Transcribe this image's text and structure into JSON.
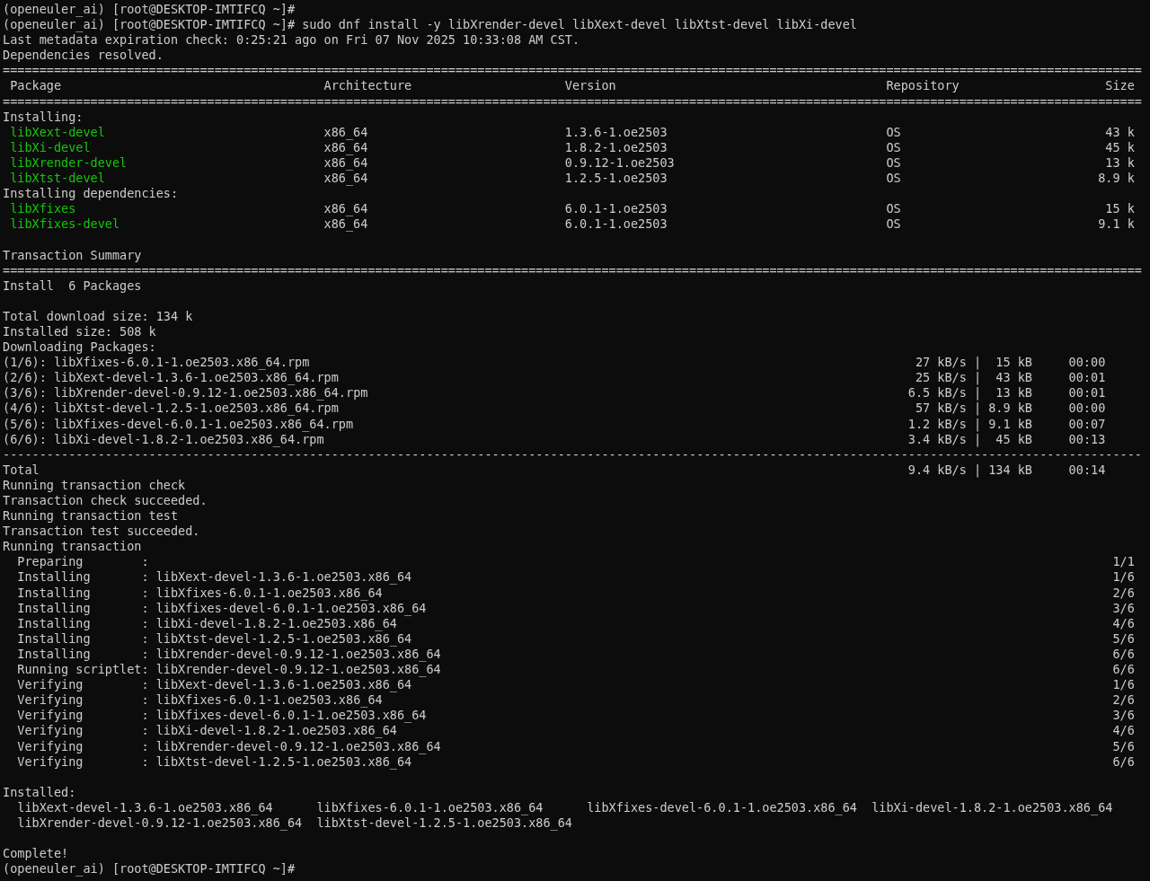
{
  "terminal": {
    "lines": [
      {
        "kind": "text",
        "text": "(openeuler_ai) [root@DESKTOP-IMTIFCQ ~]#"
      },
      {
        "kind": "text",
        "text": "(openeuler_ai) [root@DESKTOP-IMTIFCQ ~]# sudo dnf install -y libXrender-devel libXext-devel libXtst-devel libXi-devel"
      },
      {
        "kind": "text",
        "text": "Last metadata expiration check: 0:25:21 ago on Fri 07 Nov 2025 10:33:08 AM CST."
      },
      {
        "kind": "text",
        "text": "Dependencies resolved."
      },
      {
        "kind": "rule",
        "text": "============================================================================================================================================================"
      },
      {
        "kind": "header",
        "name": "Package",
        "arch": "Architecture",
        "version": "Version",
        "repo": "Repository",
        "size": "Size"
      },
      {
        "kind": "rule",
        "text": "============================================================================================================================================================"
      },
      {
        "kind": "text",
        "text": "Installing:"
      },
      {
        "kind": "package",
        "name": "libXext-devel",
        "arch": "x86_64",
        "version": "1.3.6-1.oe2503",
        "repo": "OS",
        "size": "43 k"
      },
      {
        "kind": "package",
        "name": "libXi-devel",
        "arch": "x86_64",
        "version": "1.8.2-1.oe2503",
        "repo": "OS",
        "size": "45 k"
      },
      {
        "kind": "package",
        "name": "libXrender-devel",
        "arch": "x86_64",
        "version": "0.9.12-1.oe2503",
        "repo": "OS",
        "size": "13 k"
      },
      {
        "kind": "package",
        "name": "libXtst-devel",
        "arch": "x86_64",
        "version": "1.2.5-1.oe2503",
        "repo": "OS",
        "size": "8.9 k"
      },
      {
        "kind": "text",
        "text": "Installing dependencies:"
      },
      {
        "kind": "package",
        "name": "libXfixes",
        "arch": "x86_64",
        "version": "6.0.1-1.oe2503",
        "repo": "OS",
        "size": "15 k"
      },
      {
        "kind": "package",
        "name": "libXfixes-devel",
        "arch": "x86_64",
        "version": "6.0.1-1.oe2503",
        "repo": "OS",
        "size": "9.1 k"
      },
      {
        "kind": "text",
        "text": "Transaction Summary",
        "blank_before": true
      },
      {
        "kind": "rule",
        "text": "============================================================================================================================================================"
      },
      {
        "kind": "text",
        "text": "Install  6 Packages"
      },
      {
        "kind": "text",
        "text": "Total download size: 134 k",
        "blank_before": true
      },
      {
        "kind": "text",
        "text": "Installed size: 508 k"
      },
      {
        "kind": "text",
        "text": "Downloading Packages:"
      },
      {
        "kind": "download",
        "text": "(1/6): libXfixes-6.0.1-1.oe2503.x86_64.rpm",
        "right": "27 kB/s |  15 kB     00:00"
      },
      {
        "kind": "download",
        "text": "(2/6): libXext-devel-1.3.6-1.oe2503.x86_64.rpm",
        "right": "25 kB/s |  43 kB     00:01"
      },
      {
        "kind": "download",
        "text": "(3/6): libXrender-devel-0.9.12-1.oe2503.x86_64.rpm",
        "right": "6.5 kB/s |  13 kB     00:01"
      },
      {
        "kind": "download",
        "text": "(4/6): libXtst-devel-1.2.5-1.oe2503.x86_64.rpm",
        "right": "57 kB/s | 8.9 kB     00:00"
      },
      {
        "kind": "download",
        "text": "(5/6): libXfixes-devel-6.0.1-1.oe2503.x86_64.rpm",
        "right": "1.2 kB/s | 9.1 kB     00:07"
      },
      {
        "kind": "download",
        "text": "(6/6): libXi-devel-1.8.2-1.oe2503.x86_64.rpm",
        "right": "3.4 kB/s |  45 kB     00:13"
      },
      {
        "kind": "rule",
        "text": "------------------------------------------------------------------------------------------------------------------------------------------------------------"
      },
      {
        "kind": "download",
        "text": "Total",
        "right": "9.4 kB/s | 134 kB     00:14"
      },
      {
        "kind": "text",
        "text": "Running transaction check"
      },
      {
        "kind": "text",
        "text": "Transaction check succeeded."
      },
      {
        "kind": "text",
        "text": "Running transaction test"
      },
      {
        "kind": "text",
        "text": "Transaction test succeeded."
      },
      {
        "kind": "text",
        "text": "Running transaction"
      },
      {
        "kind": "step",
        "text": "  Preparing        :",
        "right": "1/1"
      },
      {
        "kind": "step",
        "text": "  Installing       : libXext-devel-1.3.6-1.oe2503.x86_64",
        "right": "1/6"
      },
      {
        "kind": "step",
        "text": "  Installing       : libXfixes-6.0.1-1.oe2503.x86_64",
        "right": "2/6"
      },
      {
        "kind": "step",
        "text": "  Installing       : libXfixes-devel-6.0.1-1.oe2503.x86_64",
        "right": "3/6"
      },
      {
        "kind": "step",
        "text": "  Installing       : libXi-devel-1.8.2-1.oe2503.x86_64",
        "right": "4/6"
      },
      {
        "kind": "step",
        "text": "  Installing       : libXtst-devel-1.2.5-1.oe2503.x86_64",
        "right": "5/6"
      },
      {
        "kind": "step",
        "text": "  Installing       : libXrender-devel-0.9.12-1.oe2503.x86_64",
        "right": "6/6"
      },
      {
        "kind": "step",
        "text": "  Running scriptlet: libXrender-devel-0.9.12-1.oe2503.x86_64",
        "right": "6/6"
      },
      {
        "kind": "step",
        "text": "  Verifying        : libXext-devel-1.3.6-1.oe2503.x86_64",
        "right": "1/6"
      },
      {
        "kind": "step",
        "text": "  Verifying        : libXfixes-6.0.1-1.oe2503.x86_64",
        "right": "2/6"
      },
      {
        "kind": "step",
        "text": "  Verifying        : libXfixes-devel-6.0.1-1.oe2503.x86_64",
        "right": "3/6"
      },
      {
        "kind": "step",
        "text": "  Verifying        : libXi-devel-1.8.2-1.oe2503.x86_64",
        "right": "4/6"
      },
      {
        "kind": "step",
        "text": "  Verifying        : libXrender-devel-0.9.12-1.oe2503.x86_64",
        "right": "5/6"
      },
      {
        "kind": "step",
        "text": "  Verifying        : libXtst-devel-1.2.5-1.oe2503.x86_64",
        "right": "6/6"
      },
      {
        "kind": "text",
        "text": "Installed:",
        "blank_before": true
      },
      {
        "kind": "installed",
        "items": [
          "libXext-devel-1.3.6-1.oe2503.x86_64",
          "libXfixes-6.0.1-1.oe2503.x86_64",
          "libXfixes-devel-6.0.1-1.oe2503.x86_64",
          "libXi-devel-1.8.2-1.oe2503.x86_64"
        ]
      },
      {
        "kind": "installed",
        "items": [
          "libXrender-devel-0.9.12-1.oe2503.x86_64",
          "libXtst-devel-1.2.5-1.oe2503.x86_64"
        ]
      },
      {
        "kind": "text",
        "text": "Complete!",
        "blank_before": true
      },
      {
        "kind": "text",
        "text": "(openeuler_ai) [root@DESKTOP-IMTIFCQ ~]#"
      }
    ]
  }
}
